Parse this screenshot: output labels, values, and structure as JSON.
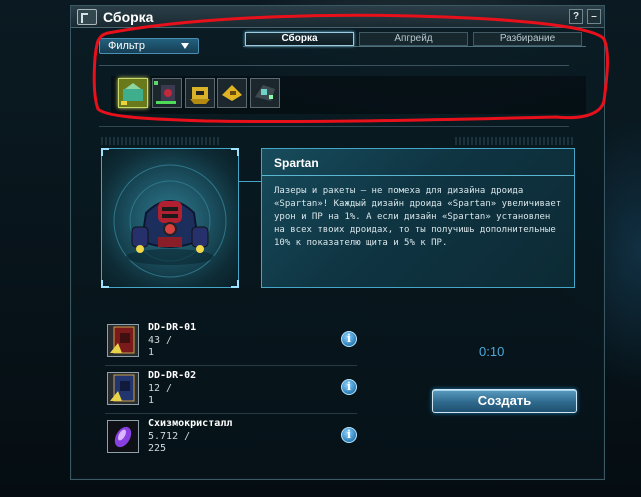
{
  "window": {
    "title": "Сборка",
    "help_label": "?",
    "close_label": "–"
  },
  "filter": {
    "label": "Фильтр"
  },
  "tabs": [
    {
      "label": "Сборка",
      "active": true
    },
    {
      "label": "Апгрейд",
      "active": false
    },
    {
      "label": "Разбирание",
      "active": false
    }
  ],
  "items": [
    {
      "icon": "droid-design-icon",
      "selected": true
    },
    {
      "icon": "droid-design-icon",
      "selected": false
    },
    {
      "icon": "droid-design-icon",
      "selected": false
    },
    {
      "icon": "droid-design-icon",
      "selected": false
    },
    {
      "icon": "droid-design-icon",
      "selected": false
    }
  ],
  "detail": {
    "name": "Spartan",
    "description": "Лазеры и ракеты — не помеха для дизайна дроида «Spartan»! Каждый дизайн дроида «Spartan» увеличивает урон и ПР на 1%. А если дизайн «Spartan» установлен на всех твоих дроидах, то ты получишь дополнительные 10% к показателю щита и 5% к ПР."
  },
  "resources": [
    {
      "name": "DD-DR-01",
      "qty": "43 /",
      "need": "1",
      "icon": "red-blueprint-icon"
    },
    {
      "name": "DD-DR-02",
      "qty": "12 /",
      "need": "1",
      "icon": "blue-blueprint-icon"
    },
    {
      "name": "Схизмокристалл",
      "qty": "5.712 /",
      "need": "225",
      "icon": "purple-crystal-icon"
    }
  ],
  "info_label": "i",
  "timer": "0:10",
  "create_label": "Создать",
  "colors": {
    "accent": "#46a6c8",
    "annotation": "#e8101a",
    "selected_item": "#c8d86a"
  }
}
